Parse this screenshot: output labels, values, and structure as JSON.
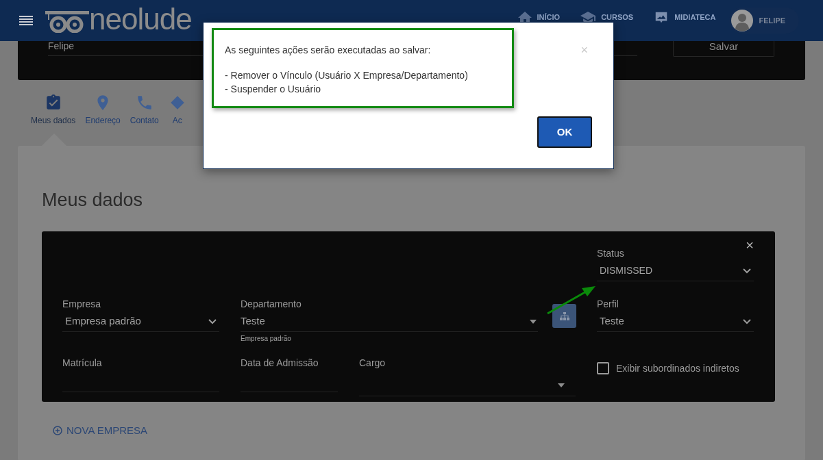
{
  "header": {
    "logo": "neolude",
    "nav": [
      {
        "label": "INÍCIO"
      },
      {
        "label": "CURSOS"
      },
      {
        "label": "MIDIATECA"
      }
    ],
    "user": "FELIPE"
  },
  "top_card": {
    "name_value": "Felipe",
    "save_button": "Salvar"
  },
  "tabs": [
    {
      "label": "Meus dados",
      "selected": true
    },
    {
      "label": "Endereço",
      "selected": false
    },
    {
      "label": "Contato",
      "selected": false
    },
    {
      "label": "Ac",
      "selected": false
    }
  ],
  "card": {
    "title": "Meus dados",
    "panel": {
      "close": "×",
      "status": {
        "label": "Status",
        "value": "DISMISSED"
      },
      "empresa": {
        "label": "Empresa",
        "value": "Empresa padrão"
      },
      "departamento": {
        "label": "Departamento",
        "value": "Teste",
        "helper": "Empresa padrão"
      },
      "perfil": {
        "label": "Perfil",
        "value": "Teste"
      },
      "matricula": {
        "label": "Matrícula"
      },
      "data_admissao": {
        "label": "Data de Admissão"
      },
      "cargo": {
        "label": "Cargo"
      },
      "checkbox": {
        "label": "Exibir subordinados indiretos",
        "checked": false
      }
    },
    "add_link": "NOVA EMPRESA"
  },
  "modal": {
    "lines": [
      "As seguintes ações serão executadas ao salvar:",
      "- Remover o Vínculo (Usuário X Empresa/Departamento)",
      "- Suspender o Usuário"
    ],
    "close": "×",
    "ok_button": "OK"
  }
}
